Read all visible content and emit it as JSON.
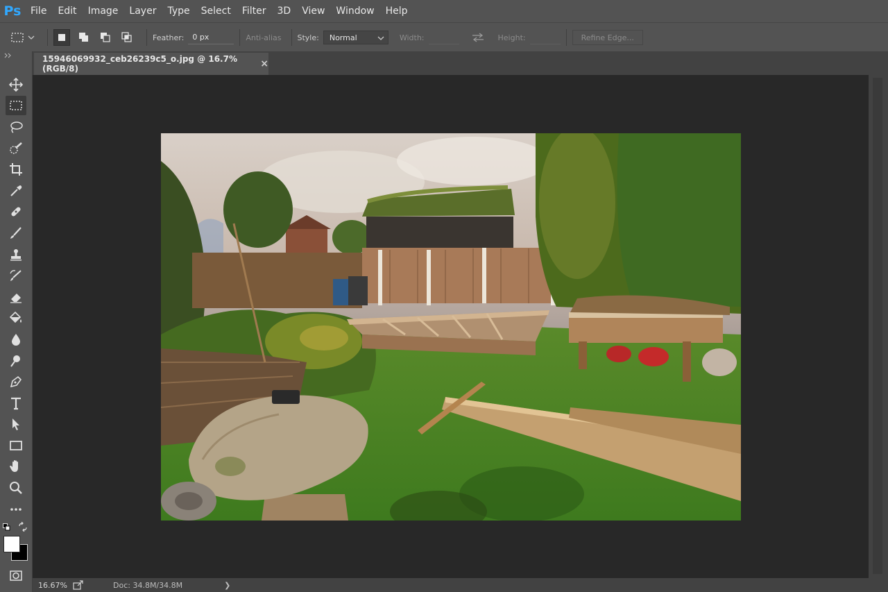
{
  "app": {
    "logo": "Ps"
  },
  "menu": [
    "File",
    "Edit",
    "Image",
    "Layer",
    "Type",
    "Select",
    "Filter",
    "3D",
    "View",
    "Window",
    "Help"
  ],
  "options": {
    "feather_label": "Feather:",
    "feather_value": "0 px",
    "antialias_label": "Anti-alias",
    "style_label": "Style:",
    "style_value": "Normal",
    "width_label": "Width:",
    "height_label": "Height:",
    "refine_edge_label": "Refine Edge..."
  },
  "document_tab": {
    "title": "15946069932_ceb26239c5_o.jpg @ 16.7% (RGB/8)",
    "close": "×"
  },
  "status": {
    "zoom": "16.67%",
    "doc_info": "Doc: 34.8M/34.8M",
    "arrow": "❯"
  },
  "toolbar_icons": [
    "move-tool-icon",
    "rectangular-marquee-icon",
    "lasso-icon",
    "quick-selection-icon",
    "crop-icon",
    "eyedropper-icon",
    "healing-brush-icon",
    "brush-icon",
    "clone-stamp-icon",
    "history-brush-icon",
    "eraser-icon",
    "paint-bucket-icon",
    "blur-icon",
    "dodge-icon",
    "pen-icon",
    "type-icon",
    "path-selection-icon",
    "rectangle-icon",
    "hand-icon",
    "zoom-icon",
    "more-tools-icon",
    "swap-colors-icon",
    "foreground-background-icon",
    "quick-mask-icon"
  ],
  "colors": {
    "accent": "#31a8ff",
    "foreground": "#ffffff",
    "background": "#000000"
  }
}
